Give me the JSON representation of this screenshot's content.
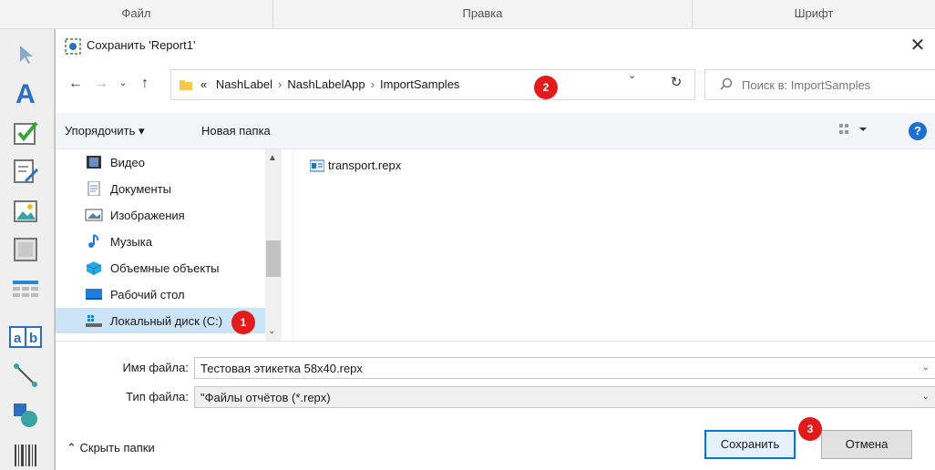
{
  "app": {
    "menu": [
      "Файл",
      "Правка",
      "Шрифт"
    ],
    "tools": [
      "pointer-tool-icon",
      "text-tool-icon",
      "checkbox-tool-icon",
      "edit-tool-icon",
      "image-tool-icon",
      "rectangle-tool-icon",
      "table-tool-icon",
      "textbox-tool-icon",
      "line-tool-icon",
      "shapes-tool-icon",
      "barcode-tool-icon"
    ]
  },
  "dialog": {
    "title": "Сохранить 'Report1'",
    "address": {
      "prefix": "«",
      "crumbs": [
        "NashLabel",
        "NashLabelApp",
        "ImportSamples"
      ]
    },
    "search": {
      "placeholder": "Поиск в: ImportSamples"
    },
    "commands": {
      "organize": "Упорядочить ▾",
      "new_folder": "Новая папка"
    },
    "nav_items": [
      {
        "label": "Видео",
        "icon": "video-folder-icon"
      },
      {
        "label": "Документы",
        "icon": "documents-folder-icon"
      },
      {
        "label": "Изображения",
        "icon": "pictures-folder-icon"
      },
      {
        "label": "Музыка",
        "icon": "music-folder-icon"
      },
      {
        "label": "Объемные объекты",
        "icon": "3d-objects-icon"
      },
      {
        "label": "Рабочий стол",
        "icon": "desktop-icon"
      },
      {
        "label": "Локальный диск (C:)",
        "icon": "local-disk-icon",
        "selected": true
      }
    ],
    "files": [
      {
        "name": "transport.repx",
        "icon": "repx-file-icon"
      }
    ],
    "filename": {
      "label": "Имя файла:",
      "value": "Тестовая этикетка 58x40.repx"
    },
    "filetype": {
      "label": "Тип файла:",
      "value": "\"Файлы отчётов (*.repx)"
    },
    "hide_folders": "⌃  Скрыть папки",
    "buttons": {
      "save": "Сохранить",
      "cancel": "Отмена"
    }
  },
  "annotations": [
    "1",
    "2",
    "3"
  ],
  "colors": {
    "accent": "#0078d7",
    "selection": "#cce4f7",
    "badge": "#e21b1b"
  }
}
